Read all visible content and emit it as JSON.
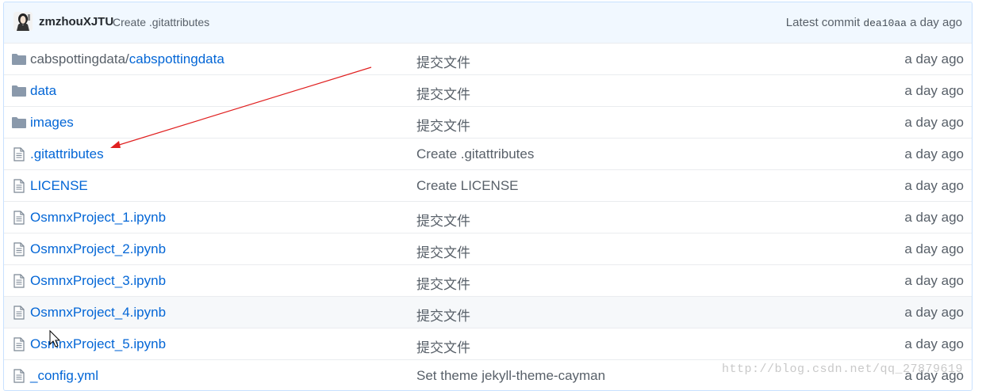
{
  "commit": {
    "author": "zmzhouXJTU",
    "message": "Create .gitattributes",
    "latest_label": "Latest commit",
    "sha": "dea10aa",
    "age": "a day ago"
  },
  "files": [
    {
      "type": "folder",
      "name_prefix": "cabspottingdata/",
      "name": "cabspottingdata",
      "message": "提交文件",
      "age": "a day ago"
    },
    {
      "type": "folder",
      "name_prefix": "",
      "name": "data",
      "message": "提交文件",
      "age": "a day ago"
    },
    {
      "type": "folder",
      "name_prefix": "",
      "name": "images",
      "message": "提交文件",
      "age": "a day ago"
    },
    {
      "type": "file",
      "name_prefix": "",
      "name": ".gitattributes",
      "message": "Create .gitattributes",
      "age": "a day ago"
    },
    {
      "type": "file",
      "name_prefix": "",
      "name": "LICENSE",
      "message": "Create LICENSE",
      "age": "a day ago"
    },
    {
      "type": "file",
      "name_prefix": "",
      "name": "OsmnxProject_1.ipynb",
      "message": "提交文件",
      "age": "a day ago"
    },
    {
      "type": "file",
      "name_prefix": "",
      "name": "OsmnxProject_2.ipynb",
      "message": "提交文件",
      "age": "a day ago"
    },
    {
      "type": "file",
      "name_prefix": "",
      "name": "OsmnxProject_3.ipynb",
      "message": "提交文件",
      "age": "a day ago"
    },
    {
      "type": "file",
      "name_prefix": "",
      "name": "OsmnxProject_4.ipynb",
      "message": "提交文件",
      "age": "a day ago",
      "hover": true
    },
    {
      "type": "file",
      "name_prefix": "",
      "name": "OsmnxProject_5.ipynb",
      "message": "提交文件",
      "age": "a day ago"
    },
    {
      "type": "file",
      "name_prefix": "",
      "name": "_config.yml",
      "message": "Set theme jekyll-theme-cayman",
      "age": "a day ago"
    }
  ],
  "watermark": "http://blog.csdn.net/qq_27879619",
  "colors": {
    "link": "#0366d6",
    "muted": "#586069",
    "folder_icon": "#79b8ff",
    "annotation_arrow": "#e02020",
    "commit_bar_bg": "#f1f8ff"
  },
  "icons": {
    "folder": "folder-icon",
    "file": "file-text-icon",
    "avatar": "user-avatar",
    "cursor": "mouse-cursor-icon",
    "arrow": "annotation-arrow"
  }
}
